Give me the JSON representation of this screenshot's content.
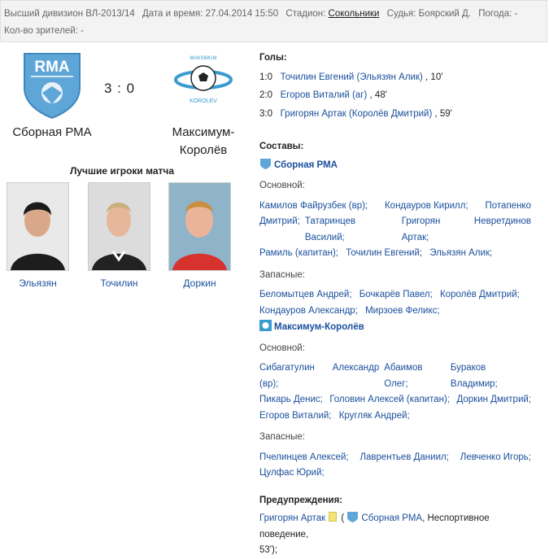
{
  "info": {
    "division": "Высший дивизион ВЛ-2013/14",
    "datetime": "Дата и время: 27.04.2014 15:50",
    "stadium_label": "Стадион:",
    "stadium": "Сокольники",
    "referee": "Судья: Боярский Д.",
    "weather": "Погода: -",
    "spectators": "Кол-во зрителей: -"
  },
  "home": {
    "name": "Сборная РМА",
    "logo_text": "RMA"
  },
  "away": {
    "name_line1": "Максимум-",
    "name_line2": "Королёв",
    "logo_top": "MAKSIMUM",
    "logo_bottom": "KOROLEV"
  },
  "score": "3 : 0",
  "best_players": {
    "title": "Лучшие игроки матча",
    "players": [
      "Эльязян",
      "Точилин",
      "Доркин"
    ]
  },
  "goals": {
    "title": "Голы:",
    "items": [
      {
        "score": "1:0",
        "text": "Точилин Евгений (Эльязян Алик)",
        "minute": ", 10'"
      },
      {
        "score": "2:0",
        "text": "Егоров Виталий (аг)",
        "minute": ", 48'"
      },
      {
        "score": "3:0",
        "text": "Григорян Артак (Королёв Дмитрий)",
        "minute": ", 59'"
      }
    ]
  },
  "lineups": {
    "title": "Составы:",
    "main_label": "Основной:",
    "subs_label": "Запасные:",
    "home": {
      "name": "Сборная РМА",
      "main_lines": [
        [
          "Камилов Файрузбек (вр);",
          "Кондауров Кирилл;",
          "Потапенко"
        ],
        [
          "Дмитрий;",
          "Татаринцев Василий;",
          "Григорян Артак;",
          "Невретдинов"
        ],
        [
          "Рамиль (капитан);",
          "Точилин Евгений;",
          "Эльязян Алик;"
        ]
      ],
      "subs_lines": [
        [
          "Беломытцев Андрей;",
          "Бочкарёв Павел;",
          "Королёв Дмитрий;"
        ],
        [
          "Кондауров Александр;",
          "Мирзоев Феликс;"
        ]
      ]
    },
    "away": {
      "name": "Максимум-Королёв",
      "main_lines": [
        [
          "Сибагатулин Александр (вр);",
          "Абаимов Олег;",
          "Бураков Владимир;"
        ],
        [
          "Пикарь Денис;",
          "Головин Алексей (капитан);",
          "Доркин Дмитрий;"
        ],
        [
          "Егоров Виталий;",
          "Кругляк Андрей;"
        ]
      ],
      "subs_lines": [
        [
          "Пчелинцев Алексей;",
          "Лаврентьев Даниил;",
          "Левченко Игорь;"
        ],
        [
          "Цулфас Юрий;"
        ]
      ]
    }
  },
  "warnings": {
    "title": "Предупреждения:",
    "player": "Григорян Артак",
    "open_paren": "(",
    "team": "Сборная РМА",
    "reason_line1": ", Неспортивное поведение,",
    "reason_line2": "53');"
  },
  "colors": {
    "link": "#1a4f9c",
    "info_bg": "#f3f3f3",
    "card": "#f2e27a"
  }
}
